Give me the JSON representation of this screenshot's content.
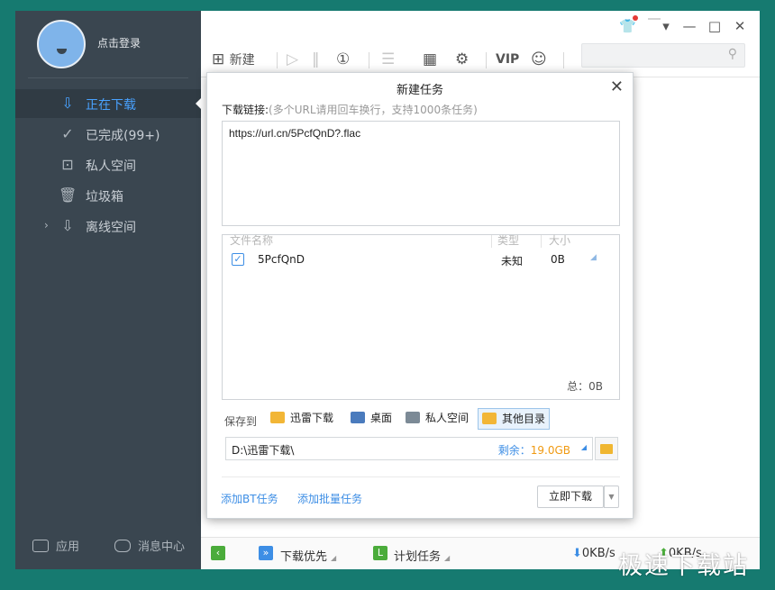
{
  "sidebar": {
    "login": "点击登录",
    "items": [
      {
        "label": "正在下载",
        "icon": "download-icon"
      },
      {
        "label": "已完成(99+)",
        "icon": "check-circle-icon"
      },
      {
        "label": "私人空间",
        "icon": "lock-icon"
      },
      {
        "label": "垃圾箱",
        "icon": "trash-icon"
      },
      {
        "label": "离线空间",
        "icon": "cloud-download-icon"
      }
    ],
    "footer": {
      "apps": "应用",
      "messages": "消息中心"
    }
  },
  "toolbar": {
    "new_label": "新建"
  },
  "statusbar": {
    "priority": "下载优先",
    "schedule": "计划任务",
    "down_speed": "0KB/s",
    "up_speed": "0KB/s"
  },
  "dialog": {
    "title": "新建任务",
    "link_label": "下载链接:",
    "link_hint": "(多个URL请用回车换行，支持1000条任务)",
    "url": "https://url.cn/5PcfQnD?.flac",
    "columns": [
      "文件名称",
      "类型",
      "大小"
    ],
    "file": {
      "name": "5PcfQnD",
      "type": "未知",
      "size": "0B",
      "checked": true
    },
    "total": "总：0B",
    "save_label": "保存到",
    "destinations": [
      {
        "label": "迅雷下载",
        "color": "#f2b636"
      },
      {
        "label": "桌面",
        "color": "#4a7bbd"
      },
      {
        "label": "私人空间",
        "color": "#7c8a96"
      },
      {
        "label": "其他目录",
        "color": "#f2b636",
        "selected": true
      }
    ],
    "path": "D:\\迅雷下载\\",
    "free_label": "剩余：",
    "free_value": "19.0GB",
    "add_bt": "添加BT任务",
    "add_batch": "添加批量任务",
    "download_now": "立即下载"
  },
  "watermark": "极速下载站",
  "colors": {
    "accent": "#3d8ee5",
    "sidebar": "#3a4650",
    "background": "#167a70"
  }
}
